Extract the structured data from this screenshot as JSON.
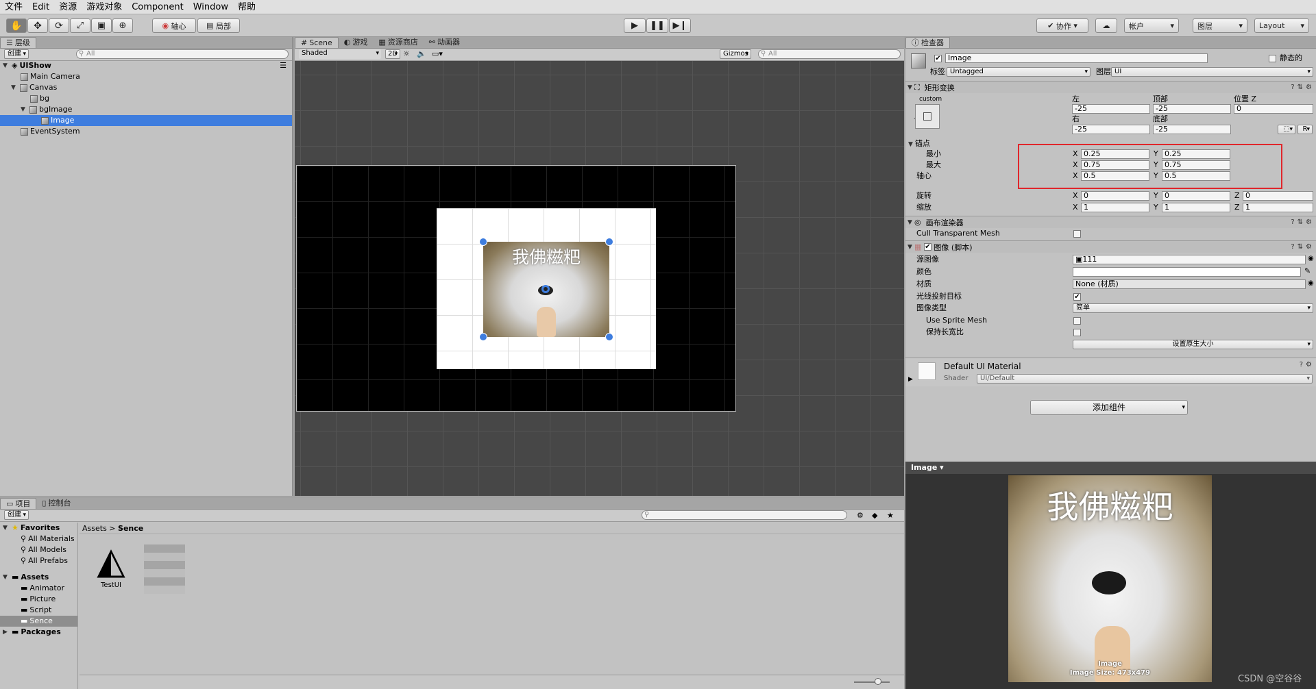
{
  "menu": [
    "文件",
    "Edit",
    "资源",
    "游戏对象",
    "Component",
    "Window",
    "帮助"
  ],
  "toolbar": {
    "pivot": "轴心",
    "local": "局部",
    "collab": "协作",
    "account": "帐户",
    "layers": "图层",
    "layout": "Layout"
  },
  "hierarchy": {
    "tab": "层级",
    "create": "创建",
    "search_placeholder": "All",
    "scene": "UIShow",
    "items": [
      "Main Camera",
      "Canvas",
      "bg",
      "bgImage",
      "Image",
      "EventSystem"
    ]
  },
  "scene_view": {
    "tabs": [
      "Scene",
      "游戏",
      "资源商店",
      "动画器"
    ],
    "shading": "Shaded",
    "mode_2d": "2D",
    "gizmos": "Gizmos",
    "search_placeholder": "All",
    "image_caption": "我佛糍粑"
  },
  "inspector": {
    "tab": "检查器",
    "object_name": "Image",
    "static_label": "静态的",
    "tag_label": "标签",
    "tag_value": "Untagged",
    "layer_label": "图层",
    "layer_value": "UI",
    "rect_transform": {
      "title": "矩形变换",
      "preset": "custom",
      "preset_side": "custom",
      "left_label": "左",
      "top_label": "顶部",
      "posz_label": "位置 Z",
      "left": "-25",
      "top": "-25",
      "posz": "0",
      "right_label": "右",
      "bottom_label": "底部",
      "right": "-25",
      "bottom": "-25",
      "r_button": "R",
      "anchors_label": "锚点",
      "min_label": "最小",
      "max_label": "最大",
      "pivot_label": "轴心",
      "min_x": "0.25",
      "min_y": "0.25",
      "max_x": "0.75",
      "max_y": "0.75",
      "pivot_x": "0.5",
      "pivot_y": "0.5",
      "rotation_label": "旋转",
      "scale_label": "缩放",
      "rot_x": "0",
      "rot_y": "0",
      "rot_z": "0",
      "scale_x": "1",
      "scale_y": "1",
      "scale_z": "1",
      "x": "X",
      "y": "Y",
      "z": "Z"
    },
    "canvas_renderer": {
      "title": "画布渲染器",
      "cull_label": "Cull Transparent Mesh"
    },
    "image_component": {
      "title": "图像 (脚本)",
      "source_label": "源图像",
      "source_value": "111",
      "color_label": "颜色",
      "material_label": "材质",
      "material_value": "None (材质)",
      "raycast_label": "光线投射目标",
      "type_label": "图像类型",
      "type_value": "简单",
      "sprite_mesh_label": "Use Sprite Mesh",
      "preserve_label": "保持长宽比",
      "native_size": "设置原生大小"
    },
    "material": {
      "name": "Default UI Material",
      "shader_label": "Shader",
      "shader_value": "UI/Default"
    },
    "add_component": "添加组件",
    "preview": {
      "title": "Image",
      "caption": "我佛糍粑",
      "label1": "Image",
      "label2": "Image Size: 473x479"
    }
  },
  "project": {
    "tabs": [
      "项目",
      "控制台"
    ],
    "create": "创建",
    "favorites": "Favorites",
    "fav_items": [
      "All Materials",
      "All Models",
      "All Prefabs"
    ],
    "assets": "Assets",
    "asset_folders": [
      "Animator",
      "Picture",
      "Script",
      "Sence"
    ],
    "packages": "Packages",
    "breadcrumb": [
      "Assets",
      "Sence"
    ],
    "files": [
      "TestUI"
    ]
  },
  "watermark": "CSDN @空谷谷",
  "colors": {
    "selection": "#3e7dde",
    "highlight_box": "#e0262b",
    "scene_bg": "#474747"
  }
}
